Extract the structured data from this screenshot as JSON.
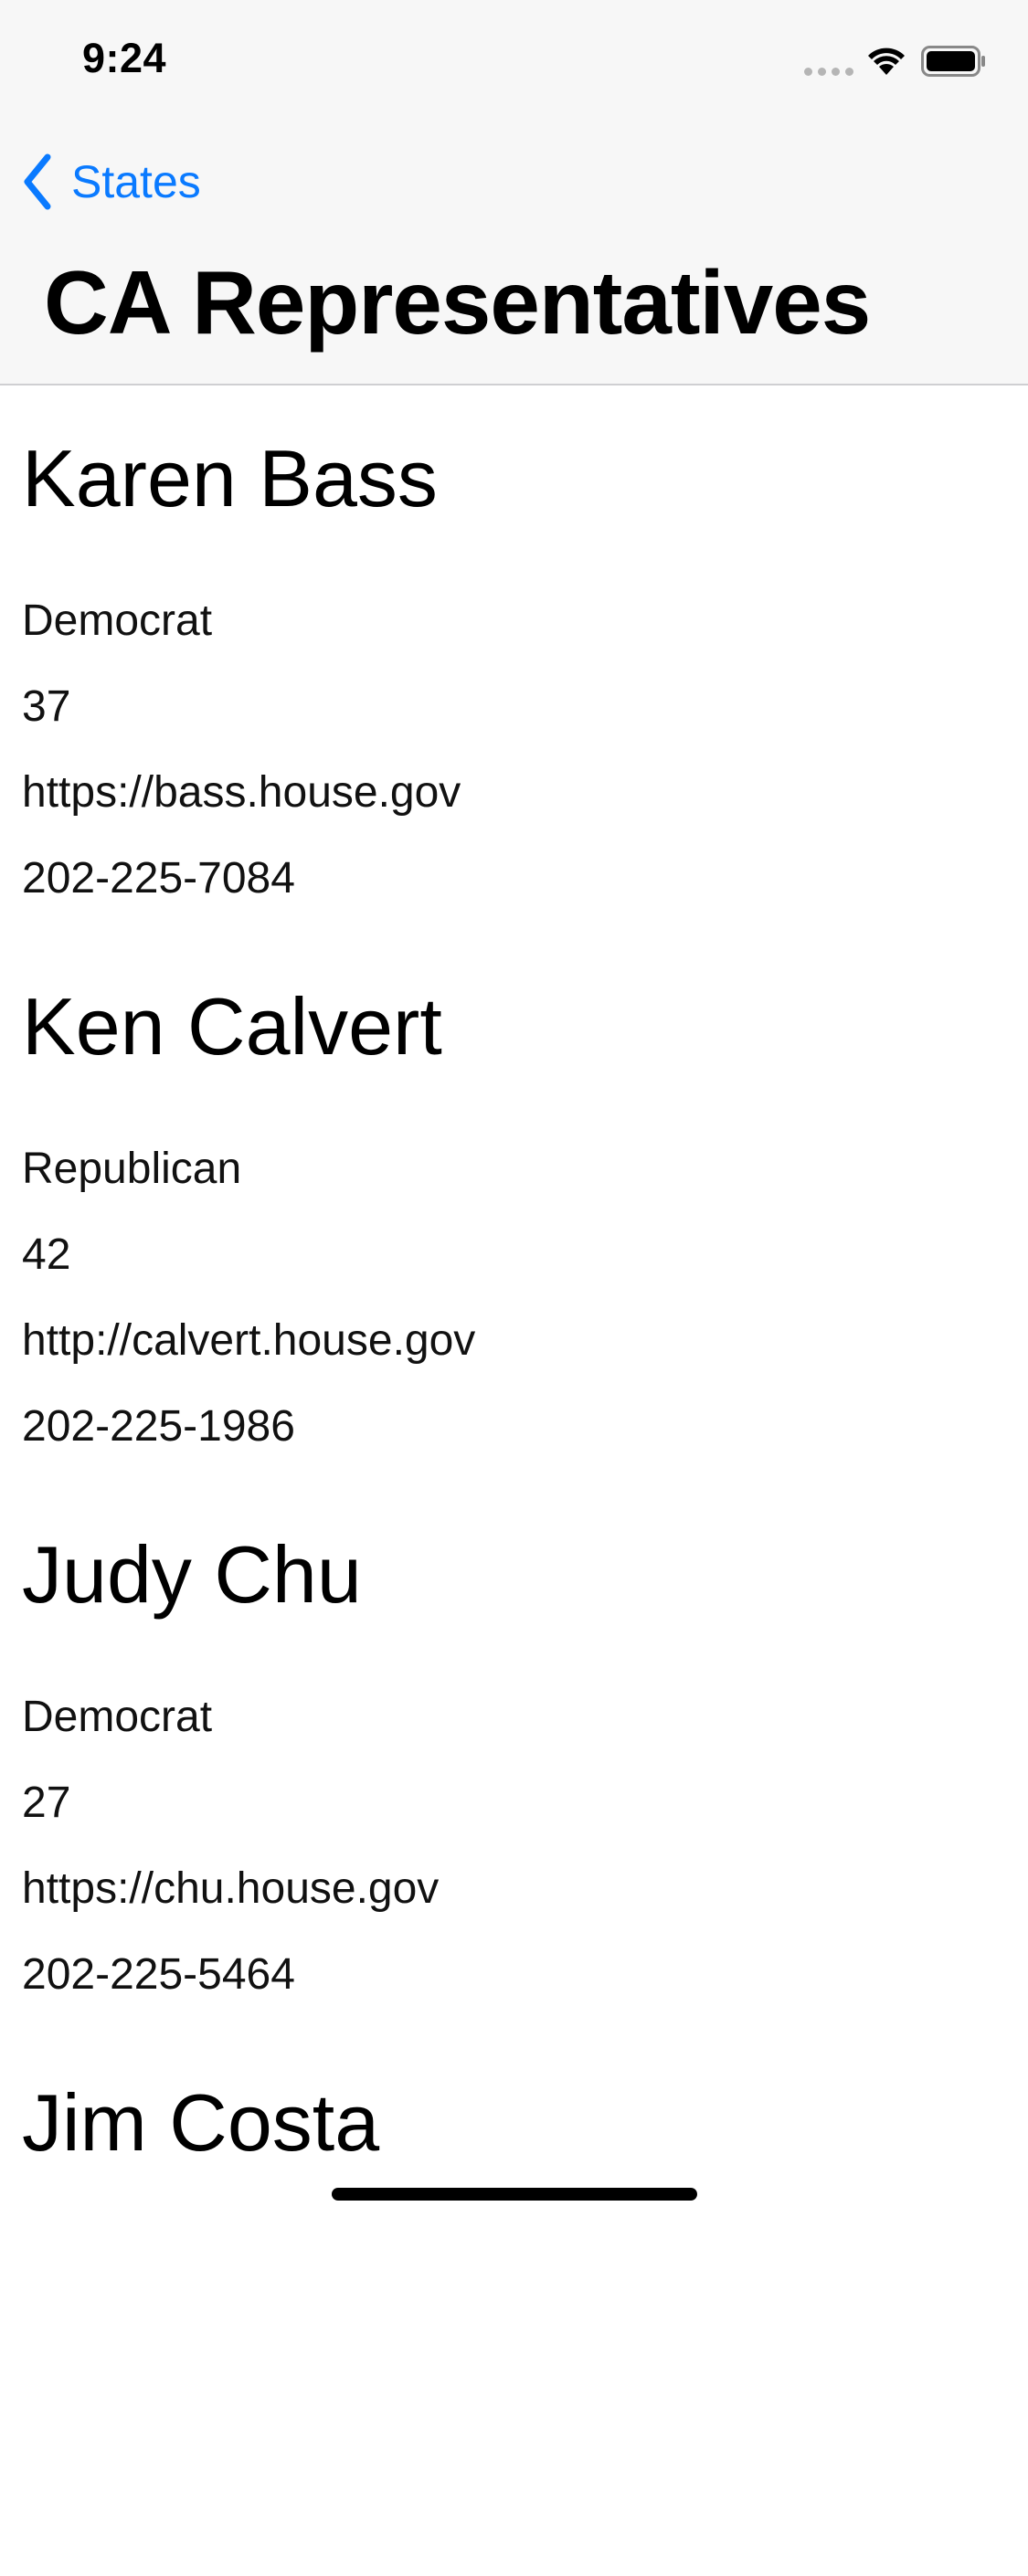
{
  "status_bar": {
    "time": "9:24",
    "icons": [
      "signal-dots-icon",
      "wifi-icon",
      "battery-icon"
    ]
  },
  "nav": {
    "back_label": "States",
    "title": "CA Representatives"
  },
  "representatives": [
    {
      "name": "Karen Bass",
      "party": "Democrat",
      "district": "37",
      "url": "https://bass.house.gov",
      "phone": "202-225-7084"
    },
    {
      "name": "Ken Calvert",
      "party": "Republican",
      "district": "42",
      "url": "http://calvert.house.gov",
      "phone": "202-225-1986"
    },
    {
      "name": "Judy Chu",
      "party": "Democrat",
      "district": "27",
      "url": "https://chu.house.gov",
      "phone": "202-225-5464"
    },
    {
      "name": "Jim Costa"
    }
  ],
  "colors": {
    "accent": "#0a7aff",
    "header_bg": "#f7f7f7",
    "separator": "#cfcfd2"
  }
}
